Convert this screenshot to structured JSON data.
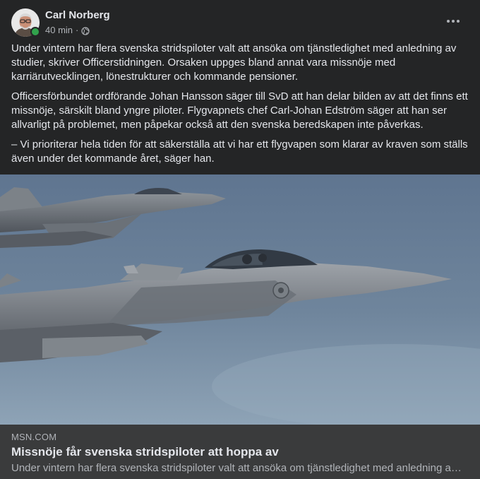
{
  "post": {
    "author": "Carl Norberg",
    "time": "40 min",
    "separator": "·",
    "privacy_icon": "globe-icon",
    "more_icon": "more-dots-icon",
    "paragraphs": [
      "Under vintern har flera svenska stridspiloter valt att ansöka om tjänstledighet med anledning av studier, skriver Officerstidningen. Orsaken uppges bland annat vara missnöje med karriärutvecklingen, lönestrukturer och kommande pensioner.",
      "Officersförbundet ordförande Johan Hansson säger till SvD att han delar bilden av att det finns ett missnöje, särskilt bland yngre piloter. Flygvapnets chef Carl-Johan Edström säger att han ser allvarligt på problemet, men påpekar också att den svenska beredskapen inte påverkas.",
      "– Vi prioriterar hela tiden för att säkerställa att vi har ett flygvapen som klarar av kraven som ställs även under det kommande året, säger han."
    ]
  },
  "link": {
    "source": "MSN.COM",
    "title": "Missnöje får svenska stridspiloter att hoppa av",
    "description": "Under vintern har flera svenska stridspiloter valt att ansöka om tjänstledighet med anledning av studier, skriver Officerstidningen."
  },
  "colors": {
    "background": "#242526",
    "card": "#3a3b3c",
    "text": "#e4e6eb",
    "secondary": "#b0b3b8",
    "online": "#31a24c"
  }
}
